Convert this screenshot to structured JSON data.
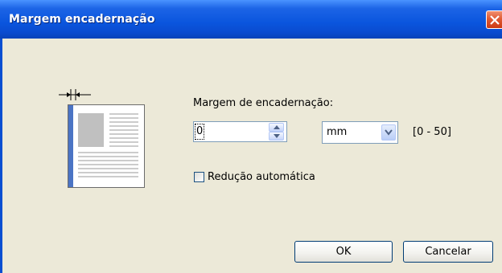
{
  "window": {
    "title": "Margem encadernação"
  },
  "form": {
    "margin_label": "Margem de encadernação:",
    "margin_value": "0",
    "unit_selected": "mm",
    "range": "[0 - 50]",
    "auto_reduce_label": "Redução automática",
    "auto_reduce_checked": false
  },
  "buttons": {
    "ok": "OK",
    "cancel": "Cancelar"
  },
  "colors": {
    "title_bar": "#0a55dd",
    "dialog_bg": "#ece9d8",
    "accent_blue": "#4b74c4",
    "close_red": "#e05a33"
  },
  "icons": [
    "close-icon",
    "binding-margin-icon",
    "document-preview-icon",
    "spin-up-icon",
    "spin-down-icon",
    "dropdown-arrow-icon"
  ]
}
